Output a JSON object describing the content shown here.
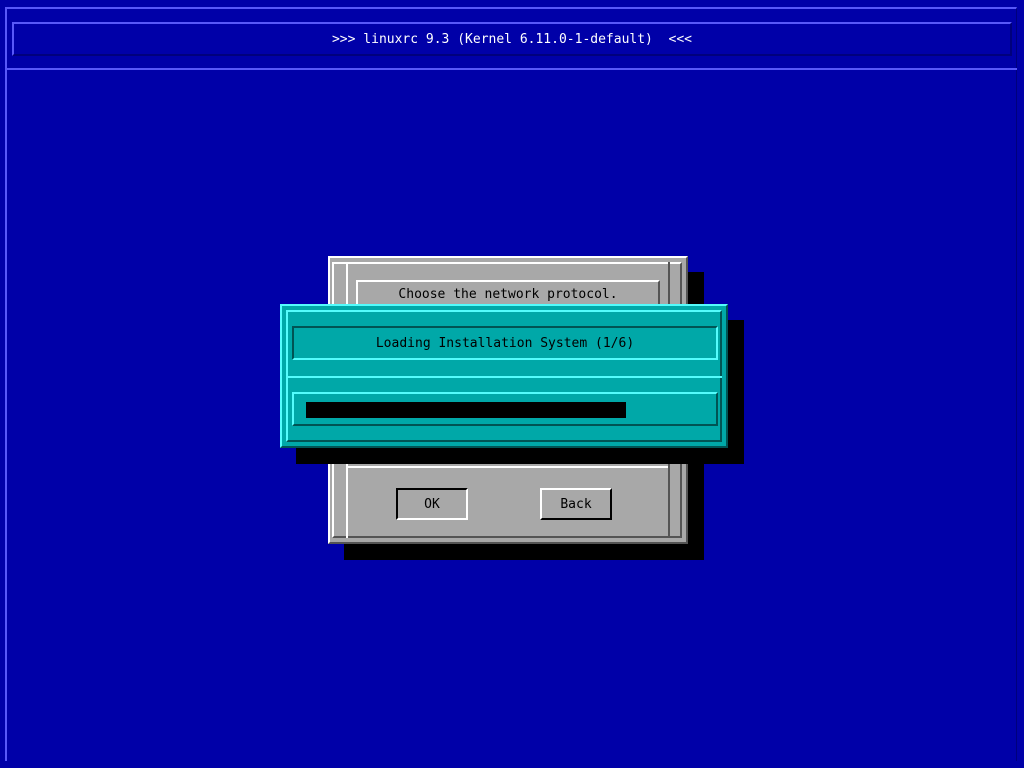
{
  "header": {
    "title": ">>> linuxrc 9.3 (Kernel 6.11.0-1-default)  <<<"
  },
  "protocol_dialog": {
    "prompt": "Choose the network protocol.",
    "ok_label": "OK",
    "back_label": "Back"
  },
  "loading_dialog": {
    "message": "Loading Installation System (1/6)",
    "progress_fraction": 0.8
  },
  "colors": {
    "background": "#0000a8",
    "dialog_grey": "#a8a8a8",
    "dialog_teal": "#00a8a8",
    "progress_fill": "#000000"
  }
}
